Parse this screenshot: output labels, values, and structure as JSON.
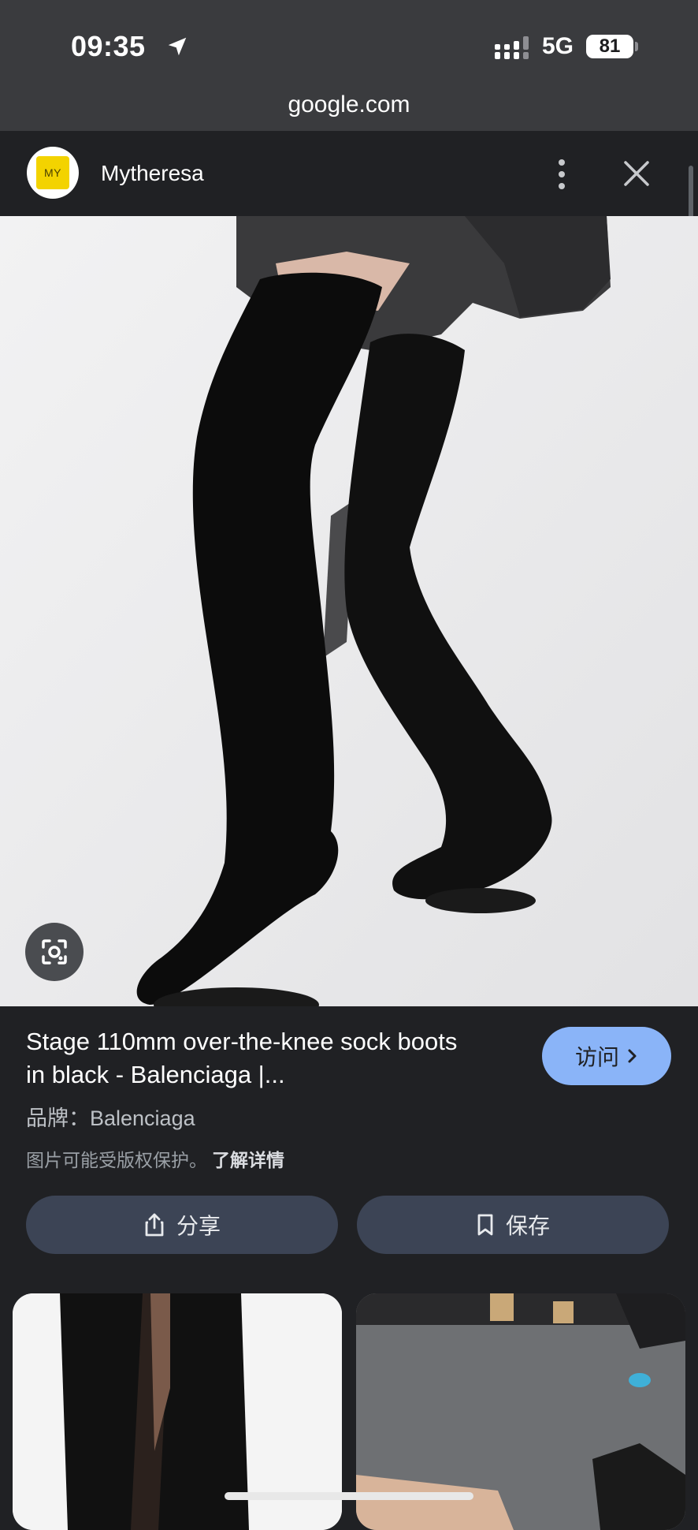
{
  "status_bar": {
    "time": "09:35",
    "network": "5G",
    "battery": "81"
  },
  "browser": {
    "url": "google.com"
  },
  "site": {
    "logo_text": "MY",
    "name": "Mytheresa"
  },
  "result": {
    "title": "Stage 110mm over-the-knee sock boots in black - Balenciaga |...",
    "visit_label": "访问",
    "brand_label": "品牌：",
    "brand_value": "Balenciaga",
    "copyright_text": "图片可能受版权保护。",
    "learn_more": "了解详情",
    "share_label": "分享",
    "save_label": "保存"
  },
  "colors": {
    "background": "#202124",
    "status_bar": "#3a3b3e",
    "visit_button": "#8ab4f8",
    "action_button": "#3c4455",
    "logo_yellow": "#f3d300"
  },
  "icons": [
    "location-arrow-icon",
    "signal-icon",
    "more-vert-icon",
    "close-icon",
    "lens-icon",
    "chevron-right-icon",
    "share-icon",
    "bookmark-icon"
  ]
}
